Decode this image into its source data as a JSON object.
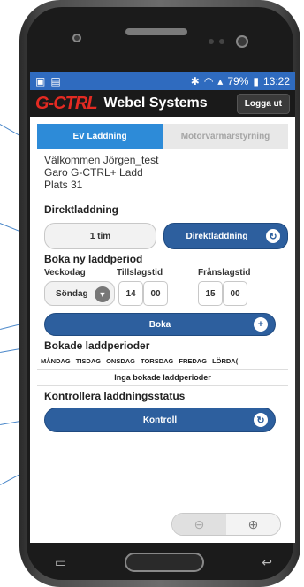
{
  "statusbar": {
    "battery": "79%",
    "time": "13:22"
  },
  "appbar": {
    "brand": "G-CTRL",
    "title": "Webel Systems",
    "logout": "Logga ut"
  },
  "tabs": [
    {
      "label": "EV Laddning",
      "active": true
    },
    {
      "label": "Motorvärmarstyrning",
      "active": false
    }
  ],
  "welcome": {
    "line1": "Välkommen Jörgen_test",
    "line2": "Garo G-CTRL+ Ladd",
    "line3": "Plats 31"
  },
  "direct": {
    "title": "Direktladdning",
    "duration": "1 tim",
    "button": "Direktladdning"
  },
  "book": {
    "title": "Boka ny laddperiod",
    "label_day": "Veckodag",
    "label_on": "Tillslagstid",
    "label_off": "Frånslagstid",
    "day": "Söndag",
    "on_h": "14",
    "on_m": "00",
    "off_h": "15",
    "off_m": "00",
    "button": "Boka"
  },
  "booked": {
    "title": "Bokade laddperioder",
    "days": [
      "MÅNDAG",
      "TISDAG",
      "ONSDAG",
      "TORSDAG",
      "FREDAG",
      "LÖRDA("
    ],
    "empty": "Inga bokade laddperioder"
  },
  "status": {
    "title": "Kontrollera laddningsstatus",
    "button": "Kontroll"
  },
  "icons": {
    "refresh": "refresh-icon",
    "plus": "plus-icon",
    "chevron": "chevron-down-icon",
    "zoom_out": "zoom-out-icon",
    "zoom_in": "zoom-in-icon"
  }
}
